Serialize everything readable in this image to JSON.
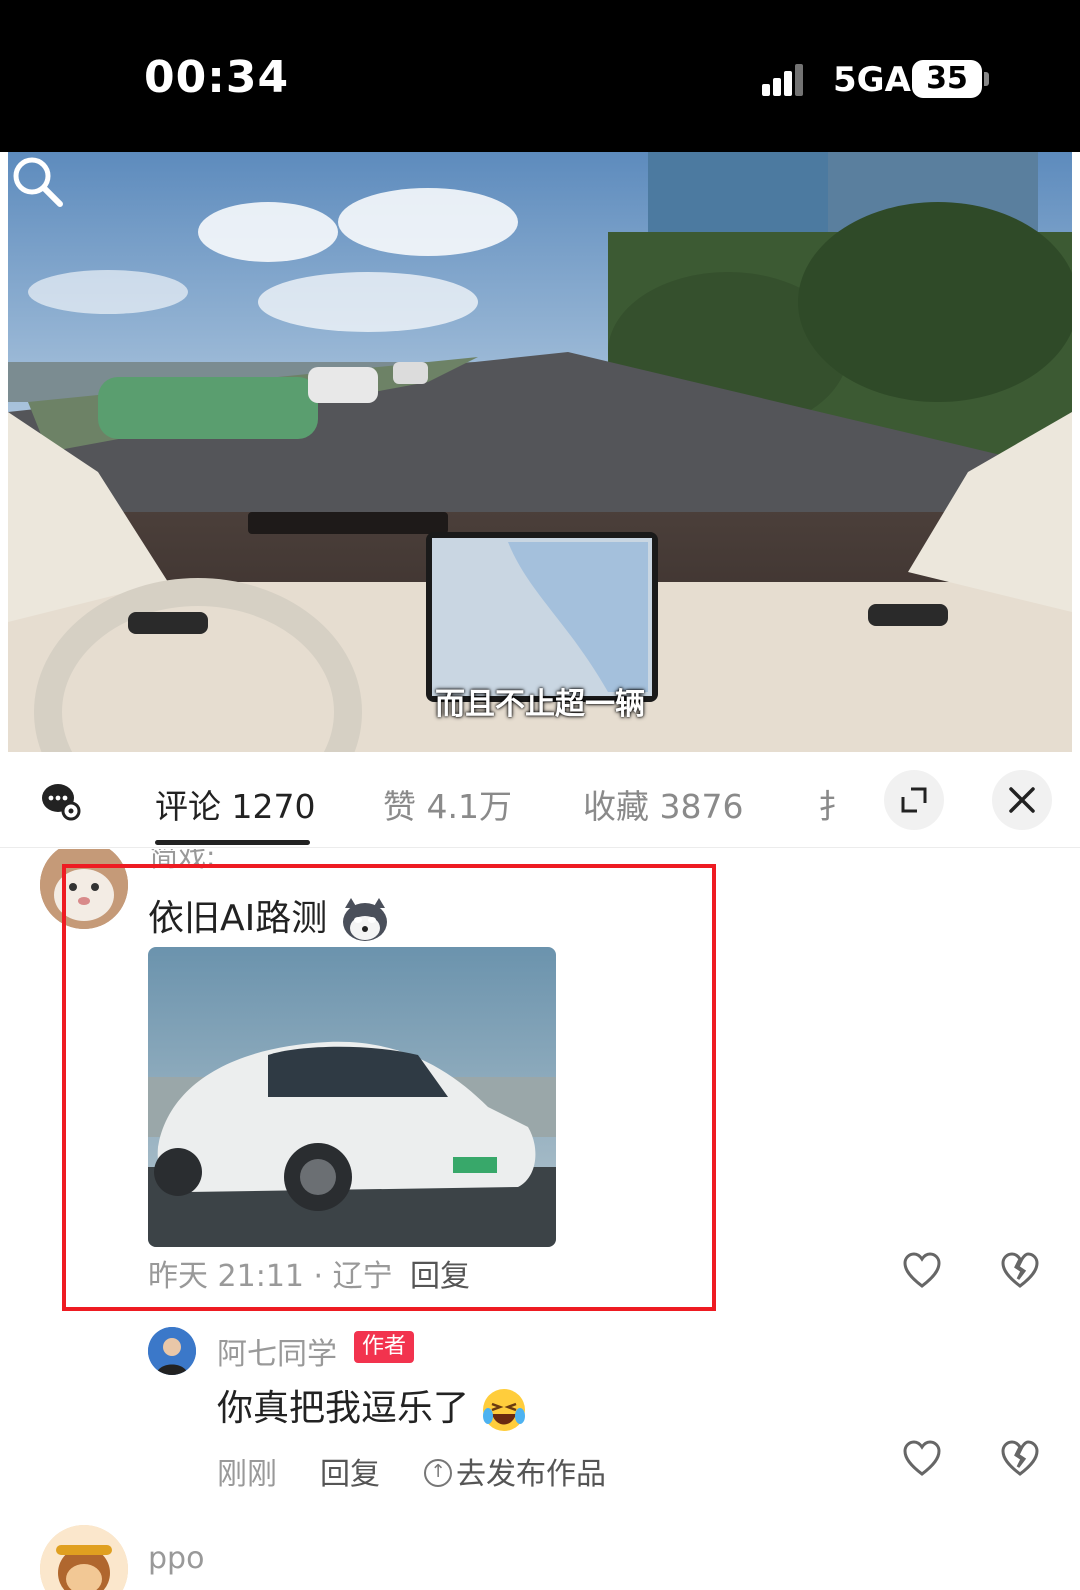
{
  "status_bar": {
    "time": "00:34",
    "network": "5GA",
    "battery": "35"
  },
  "video": {
    "subtitle": "而且不止超一辆",
    "search_icon": "search-icon"
  },
  "sheet": {
    "tabs": [
      {
        "label": "评论 1270",
        "active": true
      },
      {
        "label": "赞 4.1万",
        "active": false
      },
      {
        "label": "收藏 3876",
        "active": false
      },
      {
        "label": "扌",
        "active": false
      }
    ],
    "icons": {
      "left": "comment-settings-icon",
      "expand": "expand-icon",
      "close": "close-icon"
    }
  },
  "comments": {
    "previous_name_fragment": "简戏:",
    "main": {
      "text": "依旧AI路测",
      "meta": "昨天 21:11 · 辽宁",
      "reply_label": "回复"
    },
    "reply": {
      "author": "阿七同学",
      "author_tag": "作者",
      "text": "你真把我逗乐了",
      "meta": "刚刚",
      "reply_label": "回复",
      "publish_label": "去发布作品"
    },
    "next": {
      "author": "ppo"
    }
  },
  "colors": {
    "highlight": "#ee1b22",
    "author_tag": "#f2334e"
  }
}
